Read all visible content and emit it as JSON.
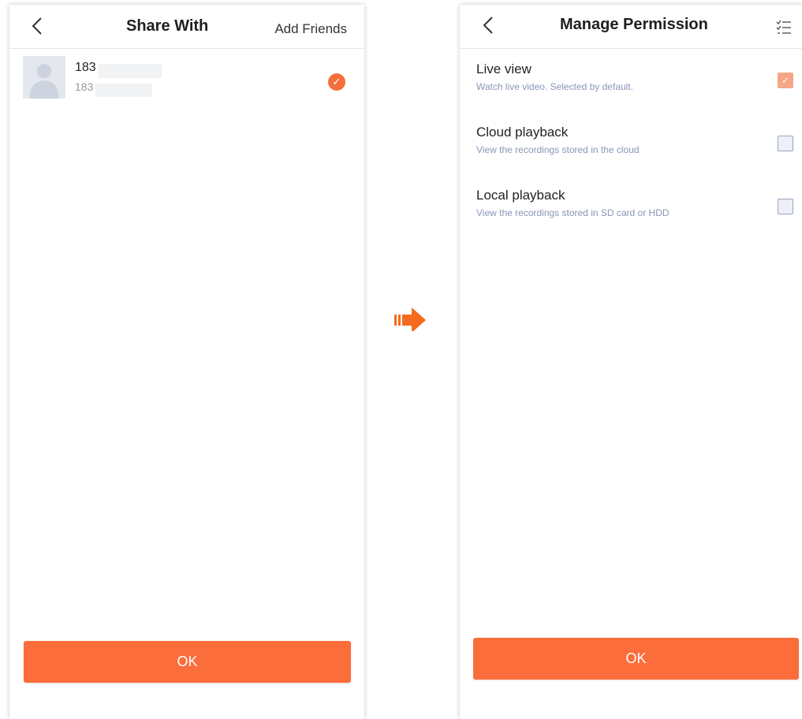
{
  "share_with": {
    "title": "Share With",
    "add_friends_label": "Add Friends",
    "contact": {
      "name": "183",
      "phone": "183",
      "selected": true,
      "check_glyph": "✓"
    },
    "ok_label": "OK"
  },
  "manage_permission": {
    "title": "Manage Permission",
    "permissions": [
      {
        "title": "Live view",
        "description": "Watch live video. Selected by default.",
        "checked": true,
        "check_glyph": "✓"
      },
      {
        "title": "Cloud playback",
        "description": "View the recordings stored in the cloud",
        "checked": false,
        "check_glyph": ""
      },
      {
        "title": "Local playback",
        "description": "View the recordings stored in SD card or HDD",
        "checked": false,
        "check_glyph": ""
      }
    ],
    "ok_label": "OK"
  },
  "colors": {
    "accent": "#fb6d3a",
    "checked_disabled": "#f7a587",
    "description_text": "#8a96b8"
  },
  "icons": [
    "back-icon",
    "checkmark-icon",
    "select-all-list-icon",
    "right-arrow-icon",
    "avatar-placeholder-icon"
  ]
}
